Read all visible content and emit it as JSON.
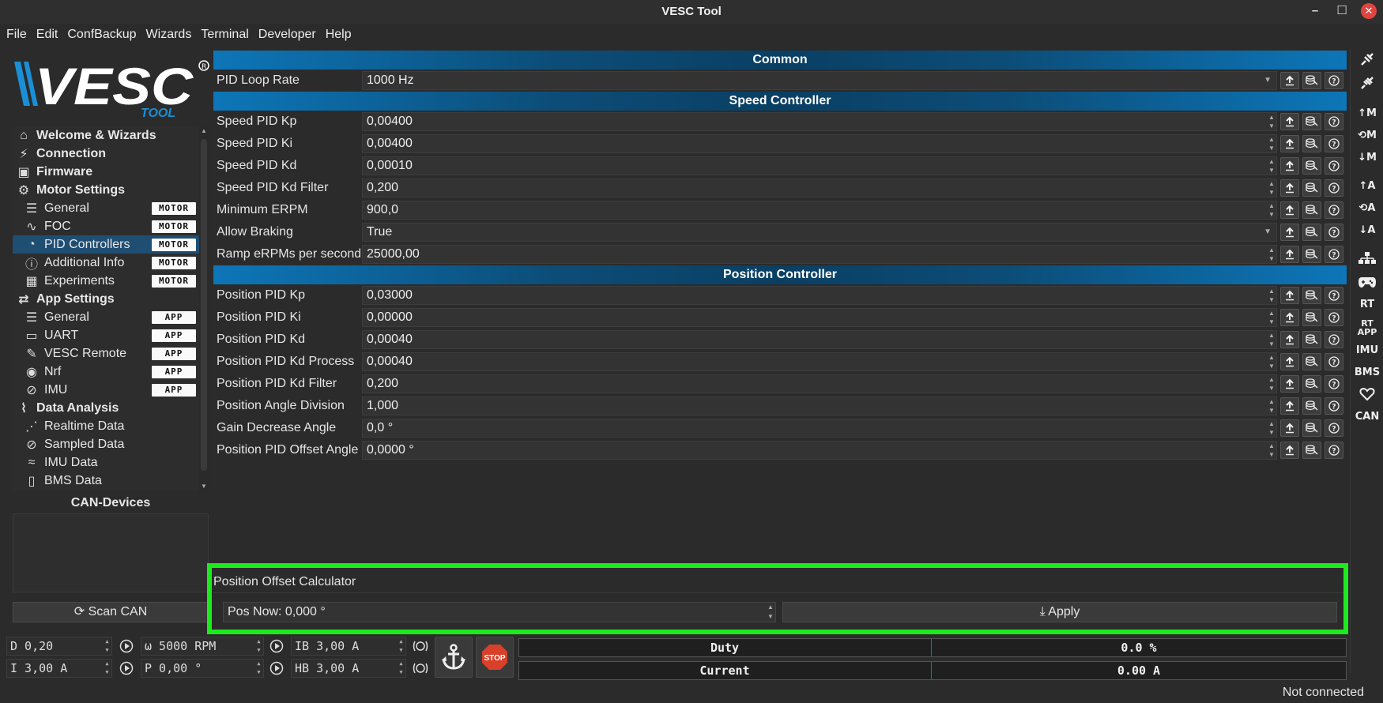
{
  "window": {
    "title": "VESC Tool"
  },
  "menu": [
    "File",
    "Edit",
    "ConfBackup",
    "Wizards",
    "Terminal",
    "Developer",
    "Help"
  ],
  "logo": {
    "text": "VESC",
    "sub": "TOOL"
  },
  "nav": {
    "items": [
      {
        "label": "Welcome & Wizards",
        "level": "top",
        "icon": "home-icon"
      },
      {
        "label": "Connection",
        "level": "top",
        "icon": "plug-icon"
      },
      {
        "label": "Firmware",
        "level": "top",
        "icon": "chip-icon"
      },
      {
        "label": "Motor Settings",
        "level": "top",
        "icon": "motor-icon"
      },
      {
        "label": "General",
        "level": "sub",
        "icon": "sliders-icon",
        "badge": "MOTOR"
      },
      {
        "label": "FOC",
        "level": "sub",
        "icon": "coil-icon",
        "badge": "MOTOR"
      },
      {
        "label": "PID Controllers",
        "level": "sub",
        "icon": "gauge-icon",
        "badge": "MOTOR",
        "selected": true
      },
      {
        "label": "Additional Info",
        "level": "sub",
        "icon": "info-icon",
        "badge": "MOTOR"
      },
      {
        "label": "Experiments",
        "level": "sub",
        "icon": "calculator-icon",
        "badge": "MOTOR"
      },
      {
        "label": "App Settings",
        "level": "top",
        "icon": "app-settings-icon"
      },
      {
        "label": "General",
        "level": "sub",
        "icon": "sliders-icon",
        "badge": "APP"
      },
      {
        "label": "UART",
        "level": "sub",
        "icon": "serial-icon",
        "badge": "APP"
      },
      {
        "label": "VESC Remote",
        "level": "sub",
        "icon": "remote-icon",
        "badge": "APP"
      },
      {
        "label": "Nrf",
        "level": "sub",
        "icon": "wireless-icon",
        "badge": "APP"
      },
      {
        "label": "IMU",
        "level": "sub",
        "icon": "imu-icon",
        "badge": "APP"
      },
      {
        "label": "Data Analysis",
        "level": "top",
        "icon": "chart-icon"
      },
      {
        "label": "Realtime Data",
        "level": "sub",
        "icon": "realtime-icon"
      },
      {
        "label": "Sampled Data",
        "level": "sub",
        "icon": "sampled-icon"
      },
      {
        "label": "IMU Data",
        "level": "sub",
        "icon": "wave-icon"
      },
      {
        "label": "BMS Data",
        "level": "sub",
        "icon": "battery-icon"
      }
    ]
  },
  "can": {
    "title": "CAN-Devices",
    "scan_label": "Scan CAN"
  },
  "sections": [
    {
      "title": "Common",
      "rows": [
        {
          "label": "PID Loop Rate",
          "value": "1000 Hz",
          "kind": "combo"
        }
      ]
    },
    {
      "title": "Speed Controller",
      "rows": [
        {
          "label": "Speed PID Kp",
          "value": "0,00400",
          "kind": "spin"
        },
        {
          "label": "Speed PID Ki",
          "value": "0,00400",
          "kind": "spin"
        },
        {
          "label": "Speed PID Kd",
          "value": "0,00010",
          "kind": "spin"
        },
        {
          "label": "Speed PID Kd Filter",
          "value": "0,200",
          "kind": "spin"
        },
        {
          "label": "Minimum ERPM",
          "value": "900,0",
          "kind": "spin"
        },
        {
          "label": "Allow Braking",
          "value": "True",
          "kind": "combo"
        },
        {
          "label": "Ramp eRPMs per second",
          "value": "25000,00",
          "kind": "spin"
        }
      ]
    },
    {
      "title": "Position Controller",
      "rows": [
        {
          "label": "Position PID Kp",
          "value": "0,03000",
          "kind": "spin"
        },
        {
          "label": "Position PID Ki",
          "value": "0,00000",
          "kind": "spin"
        },
        {
          "label": "Position PID Kd",
          "value": "0,00040",
          "kind": "spin"
        },
        {
          "label": "Position PID Kd Process",
          "value": "0,00040",
          "kind": "spin"
        },
        {
          "label": "Position PID Kd Filter",
          "value": "0,200",
          "kind": "spin"
        },
        {
          "label": "Position Angle Division",
          "value": "1,000",
          "kind": "spin"
        },
        {
          "label": "Gain Decrease Angle",
          "value": "0,0 °",
          "kind": "spin"
        },
        {
          "label": "Position PID Offset Angle",
          "value": "0,0000 °",
          "kind": "spin"
        }
      ]
    }
  ],
  "calculator": {
    "title": "Position Offset Calculator",
    "pos_now": "Pos Now: 0,000 °",
    "apply_label": "Apply"
  },
  "controls": {
    "duty": "D 0,20",
    "current": "I 3,00 A",
    "rpm": "ω 5000 RPM",
    "position": "P 0,00 °",
    "brake_current": "IB 3,00 A",
    "handbrake": "HB 3,00 A",
    "stop_label": "STOP"
  },
  "gauges": [
    {
      "name": "Duty",
      "value": "0.0 %"
    },
    {
      "name": "Current",
      "value": "0.00 A"
    }
  ],
  "status": "Not connected",
  "right_toolbar": [
    "↑M",
    "⟲M",
    "↓M",
    "↑A",
    "⟲A",
    "↓A",
    "RT",
    "RT APP",
    "IMU",
    "BMS",
    "CAN"
  ],
  "colors": {
    "accent": "#0d76b8",
    "selected": "#1f4e73",
    "highlight": "#1dea1d",
    "stop": "#d9402a"
  }
}
